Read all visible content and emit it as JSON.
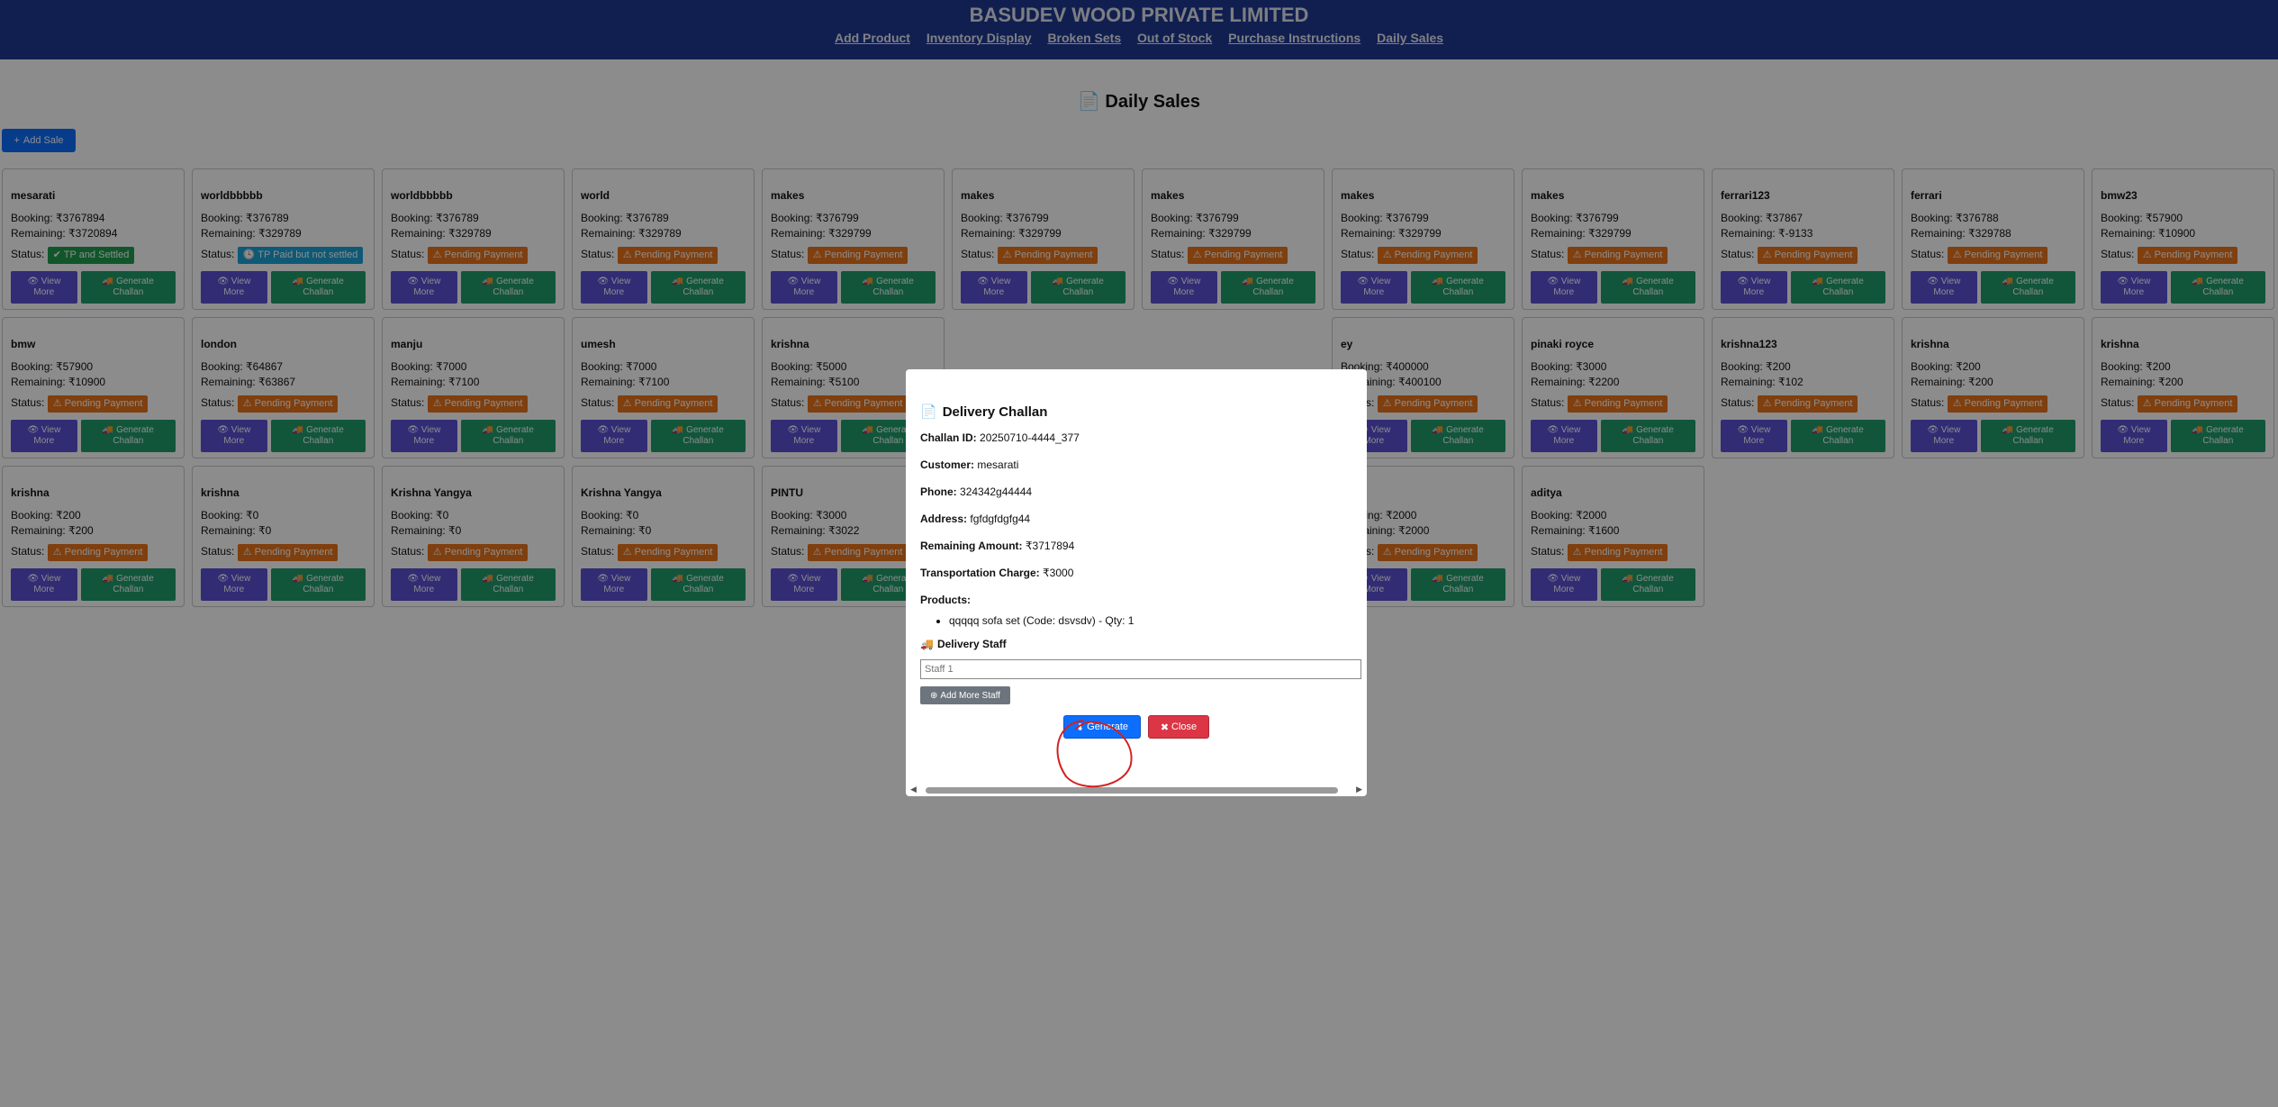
{
  "header": {
    "brand": "BASUDEV WOOD PRIVATE LIMITED",
    "nav": [
      "Add Product",
      "Inventory Display",
      "Broken Sets",
      "Out of Stock",
      "Purchase Instructions",
      "Daily Sales"
    ]
  },
  "page_title": "Daily Sales",
  "add_sale_label": "Add Sale",
  "labels": {
    "booking": "Booking:",
    "remaining": "Remaining:",
    "status": "Status:",
    "view_more": "View More",
    "generate_challan": "Generate Challan"
  },
  "cards": [
    {
      "name": "mesarati",
      "booking": "₹3767894",
      "remaining": "₹3720894",
      "status": "TP and Settled",
      "kind": "settled"
    },
    {
      "name": "worldbbbbb",
      "booking": "₹376789",
      "remaining": "₹329789",
      "status": "TP Paid but not settled",
      "kind": "tp"
    },
    {
      "name": "worldbbbbb",
      "booking": "₹376789",
      "remaining": "₹329789",
      "status": "Pending Payment",
      "kind": "pending"
    },
    {
      "name": "world",
      "booking": "₹376789",
      "remaining": "₹329789",
      "status": "Pending Payment",
      "kind": "pending"
    },
    {
      "name": "makes",
      "booking": "₹376799",
      "remaining": "₹329799",
      "status": "Pending Payment",
      "kind": "pending"
    },
    {
      "name": "makes",
      "booking": "₹376799",
      "remaining": "₹329799",
      "status": "Pending Payment",
      "kind": "pending"
    },
    {
      "name": "makes",
      "booking": "₹376799",
      "remaining": "₹329799",
      "status": "Pending Payment",
      "kind": "pending"
    },
    {
      "name": "makes",
      "booking": "₹376799",
      "remaining": "₹329799",
      "status": "Pending Payment",
      "kind": "pending"
    },
    {
      "name": "makes",
      "booking": "₹376799",
      "remaining": "₹329799",
      "status": "Pending Payment",
      "kind": "pending"
    },
    {
      "name": "ferrari123",
      "booking": "₹37867",
      "remaining": "₹-9133",
      "status": "Pending Payment",
      "kind": "pending"
    },
    {
      "name": "ferrari",
      "booking": "₹376788",
      "remaining": "₹329788",
      "status": "Pending Payment",
      "kind": "pending"
    },
    {
      "name": "bmw23",
      "booking": "₹57900",
      "remaining": "₹10900",
      "status": "Pending Payment",
      "kind": "pending"
    },
    {
      "name": "bmw",
      "booking": "₹57900",
      "remaining": "₹10900",
      "status": "Pending Payment",
      "kind": "pending"
    },
    {
      "name": "london",
      "booking": "₹64867",
      "remaining": "₹63867",
      "status": "Pending Payment",
      "kind": "pending"
    },
    {
      "name": "manju",
      "booking": "₹7000",
      "remaining": "₹7100",
      "status": "Pending Payment",
      "kind": "pending"
    },
    {
      "name": "umesh",
      "booking": "₹7000",
      "remaining": "₹7100",
      "status": "Pending Payment",
      "kind": "pending"
    },
    {
      "name": "krishna",
      "booking": "₹5000",
      "remaining": "₹5100",
      "status": "Pending Payment",
      "kind": "pending"
    },
    {
      "name": "",
      "booking": "",
      "remaining": "",
      "status": "",
      "kind": "hidden"
    },
    {
      "name": "",
      "booking": "",
      "remaining": "",
      "status": "",
      "kind": "hidden"
    },
    {
      "name": "ey",
      "booking": "₹400000",
      "remaining": "₹400100",
      "status": "Pending Payment",
      "kind": "pending"
    },
    {
      "name": "pinaki royce",
      "booking": "₹3000",
      "remaining": "₹2200",
      "status": "Pending Payment",
      "kind": "pending"
    },
    {
      "name": "krishna123",
      "booking": "₹200",
      "remaining": "₹102",
      "status": "Pending Payment",
      "kind": "pending"
    },
    {
      "name": "krishna",
      "booking": "₹200",
      "remaining": "₹200",
      "status": "Pending Payment",
      "kind": "pending"
    },
    {
      "name": "krishna",
      "booking": "₹200",
      "remaining": "₹200",
      "status": "Pending Payment",
      "kind": "pending"
    },
    {
      "name": "krishna",
      "booking": "₹200",
      "remaining": "₹200",
      "status": "Pending Payment",
      "kind": "pending"
    },
    {
      "name": "krishna",
      "booking": "₹0",
      "remaining": "₹0",
      "status": "Pending Payment",
      "kind": "pending"
    },
    {
      "name": "Krishna Yangya",
      "booking": "₹0",
      "remaining": "₹0",
      "status": "Pending Payment",
      "kind": "pending"
    },
    {
      "name": "Krishna Yangya",
      "booking": "₹0",
      "remaining": "₹0",
      "status": "Pending Payment",
      "kind": "pending"
    },
    {
      "name": "PINTU",
      "booking": "₹3000",
      "remaining": "₹3022",
      "status": "Pending Payment",
      "kind": "pending"
    },
    {
      "name": "",
      "booking": "",
      "remaining": "",
      "status": "",
      "kind": "hidden"
    },
    {
      "name": "",
      "booking": "",
      "remaining": "",
      "status": "",
      "kind": "hidden"
    },
    {
      "name": "a",
      "booking": "₹2000",
      "remaining": "₹2000",
      "status": "Pending Payment",
      "kind": "pending"
    },
    {
      "name": "aditya",
      "booking": "₹2000",
      "remaining": "₹1600",
      "status": "Pending Payment",
      "kind": "pending"
    }
  ],
  "modal": {
    "title": "Delivery Challan",
    "challan_id_label": "Challan ID:",
    "challan_id": "20250710-4444_377",
    "customer_label": "Customer:",
    "customer": "mesarati",
    "phone_label": "Phone:",
    "phone": "324342g44444",
    "address_label": "Address:",
    "address": "fgfdgfdgfg44",
    "remaining_label": "Remaining Amount:",
    "remaining": "₹3717894",
    "transport_label": "Transportation Charge:",
    "transport": "₹3000",
    "products_label": "Products:",
    "products": [
      "qqqqq sofa set (Code: dsvsdv) - Qty: 1"
    ],
    "staff_title": "Delivery Staff",
    "staff_placeholder": "Staff 1",
    "add_staff_label": "Add More Staff",
    "generate_label": "Generate",
    "close_label": "Close"
  },
  "colors": {
    "header_bg": "#1f3a93",
    "pending": "#e8731a",
    "settled": "#1f9d4e",
    "tp": "#1ba3d8",
    "view_btn": "#5b50d6",
    "gen_btn": "#1f9d6b",
    "primary": "#0d6efd",
    "danger": "#dc3545"
  }
}
